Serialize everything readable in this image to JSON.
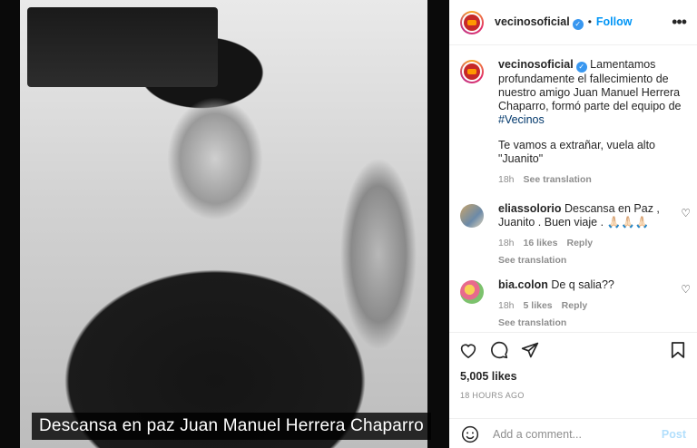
{
  "photo": {
    "caption": "Descansa en paz Juan Manuel Herrera Chaparro"
  },
  "header": {
    "username": "vecinosoficial",
    "separator": "•",
    "follow_label": "Follow",
    "more_icon": "more-horizontal-icon"
  },
  "post": {
    "username": "vecinosoficial",
    "text_part1": "Lamentamos profundamente el fallecimiento de nuestro amigo Juan Manuel Herrera Chaparro, formó parte del equipo de",
    "hashtag": "#Vecinos",
    "text_part2": "Te vamos a extrañar, vuela alto \"Juanito\"",
    "age": "18h",
    "see_translation": "See translation"
  },
  "comments": [
    {
      "username": "eliassolorio",
      "text": "Descansa en Paz , Juanito . Buen viaje . 🙏🏻🙏🏻🙏🏻",
      "age": "18h",
      "likes": "16 likes",
      "reply": "Reply",
      "see_translation": "See translation"
    },
    {
      "username": "bia.colon",
      "text": "De q salia??",
      "age": "18h",
      "likes": "5 likes",
      "reply": "Reply",
      "see_translation": "See translation"
    }
  ],
  "actions": {
    "likes": "5,005 likes",
    "time": "18 HOURS AGO"
  },
  "add_comment": {
    "placeholder": "Add a comment...",
    "post_label": "Post"
  },
  "colors": {
    "link_blue": "#0095f6",
    "post_disabled": "#b2dffc",
    "muted": "#8e8e8e"
  }
}
